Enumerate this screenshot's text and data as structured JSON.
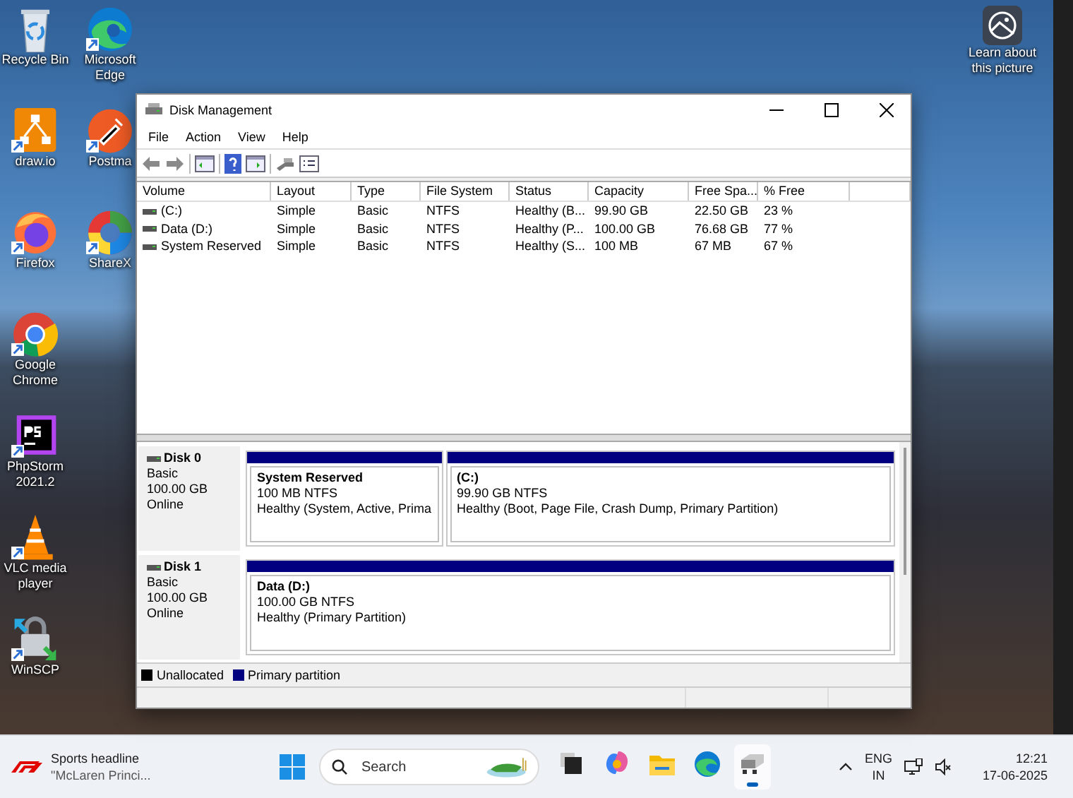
{
  "desktop": {
    "icons": [
      {
        "label": "Recycle Bin",
        "kind": "recycle",
        "shortcut": false
      },
      {
        "label": "draw.io",
        "kind": "drawio",
        "shortcut": true
      },
      {
        "label": "Firefox",
        "kind": "firefox",
        "shortcut": true
      },
      {
        "label": "Google Chrome",
        "kind": "chrome",
        "shortcut": true
      },
      {
        "label": "PhpStorm 2021.2",
        "kind": "phpstorm",
        "shortcut": true
      },
      {
        "label": "VLC media player",
        "kind": "vlc",
        "shortcut": true
      },
      {
        "label": "WinSCP",
        "kind": "winscp",
        "shortcut": true
      },
      {
        "label": "Microsoft Edge",
        "kind": "edge",
        "shortcut": true
      },
      {
        "label": "Postma",
        "kind": "postman",
        "shortcut": true
      },
      {
        "label": "ShareX",
        "kind": "sharex",
        "shortcut": true
      }
    ],
    "spotlight": {
      "label": "Learn about this picture"
    }
  },
  "window": {
    "title": "Disk Management",
    "menu": [
      "File",
      "Action",
      "View",
      "Help"
    ],
    "volume_table": {
      "columns": [
        "Volume",
        "Layout",
        "Type",
        "File System",
        "Status",
        "Capacity",
        "Free Spa...",
        "% Free"
      ],
      "rows": [
        [
          "(C:)",
          "Simple",
          "Basic",
          "NTFS",
          "Healthy (B...",
          "99.90 GB",
          "22.50 GB",
          "23 %"
        ],
        [
          "Data (D:)",
          "Simple",
          "Basic",
          "NTFS",
          "Healthy (P...",
          "100.00 GB",
          "76.68 GB",
          "77 %"
        ],
        [
          "System Reserved",
          "Simple",
          "Basic",
          "NTFS",
          "Healthy (S...",
          "100 MB",
          "67 MB",
          "67 %"
        ]
      ]
    },
    "disks": [
      {
        "name": "Disk 0",
        "type": "Basic",
        "size": "100.00 GB",
        "state": "Online",
        "partitions": [
          {
            "name": "System Reserved",
            "size": "100 MB NTFS",
            "status": "Healthy (System, Active, Prima"
          },
          {
            "name": "(C:)",
            "size": "99.90 GB NTFS",
            "status": "Healthy (Boot, Page File, Crash Dump, Primary Partition)"
          }
        ]
      },
      {
        "name": "Disk 1",
        "type": "Basic",
        "size": "100.00 GB",
        "state": "Online",
        "partitions": [
          {
            "name": "Data  (D:)",
            "size": "100.00 GB NTFS",
            "status": "Healthy (Primary Partition)"
          }
        ]
      }
    ],
    "legend": [
      {
        "label": "Unallocated",
        "color": "#000000"
      },
      {
        "label": "Primary partition",
        "color": "#000080"
      }
    ]
  },
  "taskbar": {
    "news": {
      "title": "Sports headline",
      "subtitle": "\"McLaren Princi..."
    },
    "search": {
      "placeholder": "Search"
    },
    "apps": [
      {
        "kind": "taskview",
        "selected": false
      },
      {
        "kind": "copilot",
        "selected": false
      },
      {
        "kind": "explorer",
        "selected": false
      },
      {
        "kind": "edge",
        "selected": false
      },
      {
        "kind": "diskmgmt",
        "selected": true
      }
    ],
    "language": {
      "line_1": "ENG",
      "line_2": "IN"
    },
    "time": "12:21",
    "date": "17-06-2025"
  }
}
